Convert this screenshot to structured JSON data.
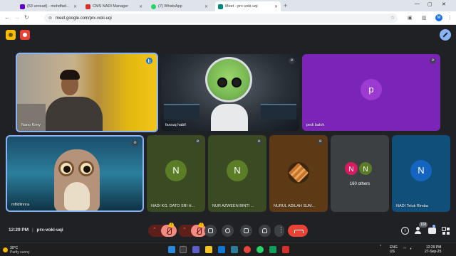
{
  "browser": {
    "tabs": [
      {
        "label": "(53 unread) - mohdfaddly@yp",
        "favicon_color": "#6001d2",
        "active": false
      },
      {
        "label": "CMS NADI Manager",
        "favicon_color": "#d93025",
        "active": false
      },
      {
        "label": "(7) WhatsApp",
        "favicon_color": "#25d366",
        "active": false
      },
      {
        "label": "Meet - prx-voki-uqi",
        "favicon_color": "#00897b",
        "active": true
      }
    ],
    "new_tab": "+",
    "url": "meet.google.com/prx-voki-uqi",
    "profile_initial": "M"
  },
  "meet": {
    "tiles": [
      {
        "name": "Nano Kimy",
        "status": "speaking"
      },
      {
        "name": "farouq habil",
        "status": "muted"
      },
      {
        "name": "pedi balok",
        "initial": "p",
        "status": "muted"
      },
      {
        "name": "mfildlinnra",
        "status": "muted"
      },
      {
        "name": "NADI KG. DATO SRI H...",
        "initial": "N",
        "status": "muted"
      },
      {
        "name": "NUR AZWEEN BINTI ...",
        "initial": "N",
        "status": "muted"
      },
      {
        "name": "NURUL ADILAH SUM...",
        "status": "muted"
      },
      {
        "name": "160 others",
        "initials": [
          "N",
          "N"
        ]
      },
      {
        "name": "NADI Teluk Rimba",
        "initial": "N",
        "status": "muted"
      }
    ],
    "footer": {
      "time": "12:29 PM",
      "separator": "|",
      "meeting_code": "prx-voki-uqi",
      "mic_badge": "!",
      "cam_badge": "!",
      "people_count": "168"
    }
  },
  "taskbar": {
    "weather_temp": "30°C",
    "weather_desc": "Partly sunny",
    "lang": "ENG",
    "region": "US",
    "time": "12:29 PM",
    "date": "27-Sep-25"
  },
  "colors": {
    "accent": "#8ab4f8",
    "end_call": "#ea4335",
    "muted_pill": "#f28b82"
  }
}
